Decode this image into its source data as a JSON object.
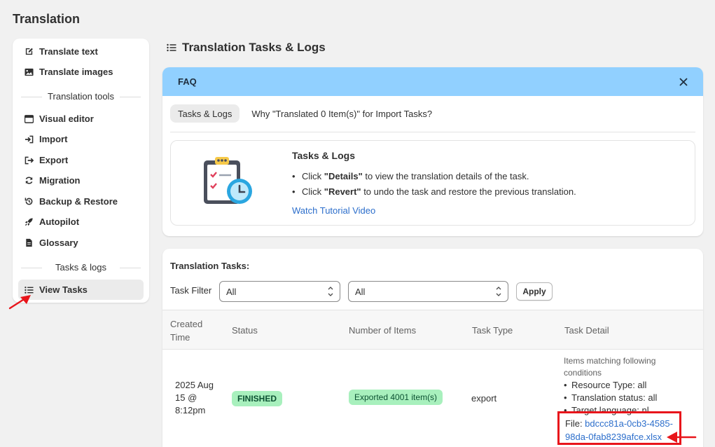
{
  "app": {
    "title": "Translation"
  },
  "sidebar": {
    "items": [
      {
        "label": "Translate text",
        "icon": "edit-icon"
      },
      {
        "label": "Translate images",
        "icon": "image-icon"
      },
      {
        "label": "Visual editor",
        "icon": "window-icon"
      },
      {
        "label": "Import",
        "icon": "import-icon"
      },
      {
        "label": "Export",
        "icon": "export-icon"
      },
      {
        "label": "Migration",
        "icon": "refresh-icon"
      },
      {
        "label": "Backup & Restore",
        "icon": "history-icon"
      },
      {
        "label": "Autopilot",
        "icon": "rocket-icon"
      },
      {
        "label": "Glossary",
        "icon": "document-icon"
      },
      {
        "label": "View Tasks",
        "icon": "list-icon",
        "active": true
      }
    ],
    "groups": {
      "tools": "Translation tools",
      "tasks": "Tasks & logs"
    }
  },
  "main": {
    "heading": "Translation Tasks & Logs",
    "faq": {
      "header": "FAQ",
      "tabs": [
        "Tasks & Logs",
        "Why \"Translated 0 Item(s)\" for Import Tasks?"
      ],
      "box_title": "Tasks & Logs",
      "bullets": [
        {
          "pre": "Click ",
          "bold": "\"Details\"",
          "post": " to view the translation details of the task."
        },
        {
          "pre": "Click ",
          "bold": "\"Revert\"",
          "post": " to undo the task and restore the previous translation."
        }
      ],
      "link": "Watch Tutorial Video"
    },
    "tasks": {
      "title": "Translation Tasks:",
      "filter_label": "Task Filter",
      "filter1": "All",
      "filter2": "All",
      "apply": "Apply",
      "columns": [
        "Created Time",
        "Status",
        "Number of Items",
        "Task Type",
        "Task Detail"
      ],
      "row": {
        "created": "2025 Aug 15 @ 8:12pm",
        "status": "FINISHED",
        "items": "Exported 4001 item(s)",
        "type": "export",
        "detail_intro": "Items matching following conditions",
        "detail_items": [
          "Resource Type: all",
          "Translation status: all",
          "Target language: nl"
        ],
        "file_label": "File: ",
        "file_link": "bdccc81a-0cb3-4585-98da-0fab8239afce.xlsx"
      }
    }
  },
  "colors": {
    "faq_header": "#91d0ff",
    "badge": "#a8f0bd",
    "link": "#2c6ecb",
    "annotation": "#e8151b"
  }
}
